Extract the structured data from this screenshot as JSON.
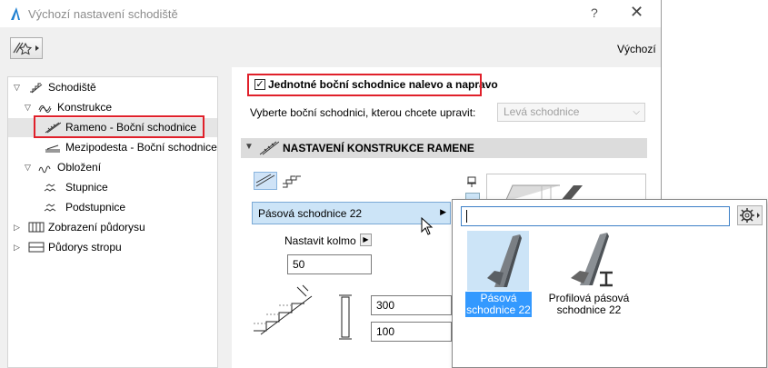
{
  "window": {
    "title": "Výchozí nastavení schodiště",
    "help": "?",
    "close": "✕"
  },
  "toolbar": {
    "default_label": "Výchozí"
  },
  "tree": [
    {
      "label": "Schodiště"
    },
    {
      "label": "Konstrukce"
    },
    {
      "label": "Rameno - Boční schodnice"
    },
    {
      "label": "Mezipodesta - Boční schodnice"
    },
    {
      "label": "Obložení"
    },
    {
      "label": "Stupnice"
    },
    {
      "label": "Podstupnice"
    },
    {
      "label": "Zobrazení půdorysu"
    },
    {
      "label": "Půdorys stropu"
    }
  ],
  "panel": {
    "checkbox_label": "Jednotné boční schodnice nalevo a napravo",
    "checkbox_mark": "✓",
    "select_label": "Vyberte boční schodnici, kterou chcete upravit:",
    "select_value": "Levá schodnice",
    "section_title": "NASTAVENÍ KONSTRUKCE RAMENE",
    "type_value": "Pásová schodnice 22",
    "nastavit_label": "Nastavit kolmo",
    "field_50": "50",
    "field_300": "300",
    "field_100": "100"
  },
  "popup": {
    "search_value": "",
    "items": [
      {
        "label_line1": "Pásová",
        "label_line2": "schodnice 22",
        "selected": true
      },
      {
        "label_line1": "Profilová pásová",
        "label_line2": "schodnice 22",
        "selected": false
      }
    ]
  },
  "colors": {
    "highlight_red": "#e0202a",
    "selection_blue": "#3399ff",
    "selection_light": "#cce4f7"
  }
}
